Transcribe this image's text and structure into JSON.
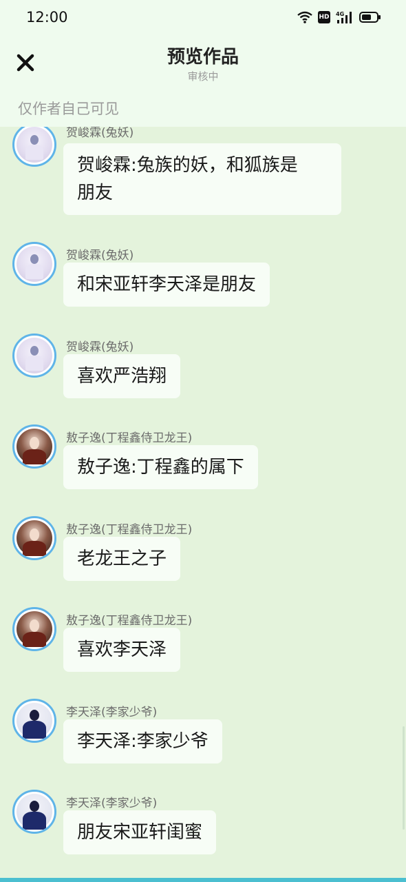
{
  "status_bar": {
    "time": "12:00",
    "hd_label": "HD",
    "network_label": "4G",
    "icons": [
      "wifi-icon",
      "hd-icon",
      "signal-4g-icon",
      "battery-icon"
    ]
  },
  "header": {
    "title": "预览作品",
    "subtitle": "审核中",
    "visibility_note": "仅作者自己可见",
    "close_icon": "close-icon"
  },
  "messages": [
    {
      "name": "贺峻霖(兔妖)",
      "text_lines": [
        "贺峻霖:兔族的妖，和狐族是",
        "朋友"
      ],
      "avatar": "rabbit"
    },
    {
      "name": "贺峻霖(兔妖)",
      "text_lines": [
        "和宋亚轩李天泽是朋友"
      ],
      "avatar": "rabbit"
    },
    {
      "name": "贺峻霖(兔妖)",
      "text_lines": [
        "喜欢严浩翔"
      ],
      "avatar": "rabbit"
    },
    {
      "name": "敖子逸(丁程鑫侍卫龙王)",
      "text_lines": [
        "敖子逸:丁程鑫的属下"
      ],
      "avatar": "dragon"
    },
    {
      "name": "敖子逸(丁程鑫侍卫龙王)",
      "text_lines": [
        "老龙王之子"
      ],
      "avatar": "dragon"
    },
    {
      "name": "敖子逸(丁程鑫侍卫龙王)",
      "text_lines": [
        "喜欢李天泽"
      ],
      "avatar": "dragon"
    },
    {
      "name": "李天泽(李家少爷)",
      "text_lines": [
        "李天泽:李家少爷"
      ],
      "avatar": "young"
    },
    {
      "name": "李天泽(李家少爷)",
      "text_lines": [
        "朋友宋亚轩闺蜜"
      ],
      "avatar": "young"
    }
  ],
  "colors": {
    "chat_background": "#e4f3dc",
    "header_background": "#effbee",
    "bubble_background": "#f7fdf6",
    "avatar_ring": "#5fb4e8"
  }
}
